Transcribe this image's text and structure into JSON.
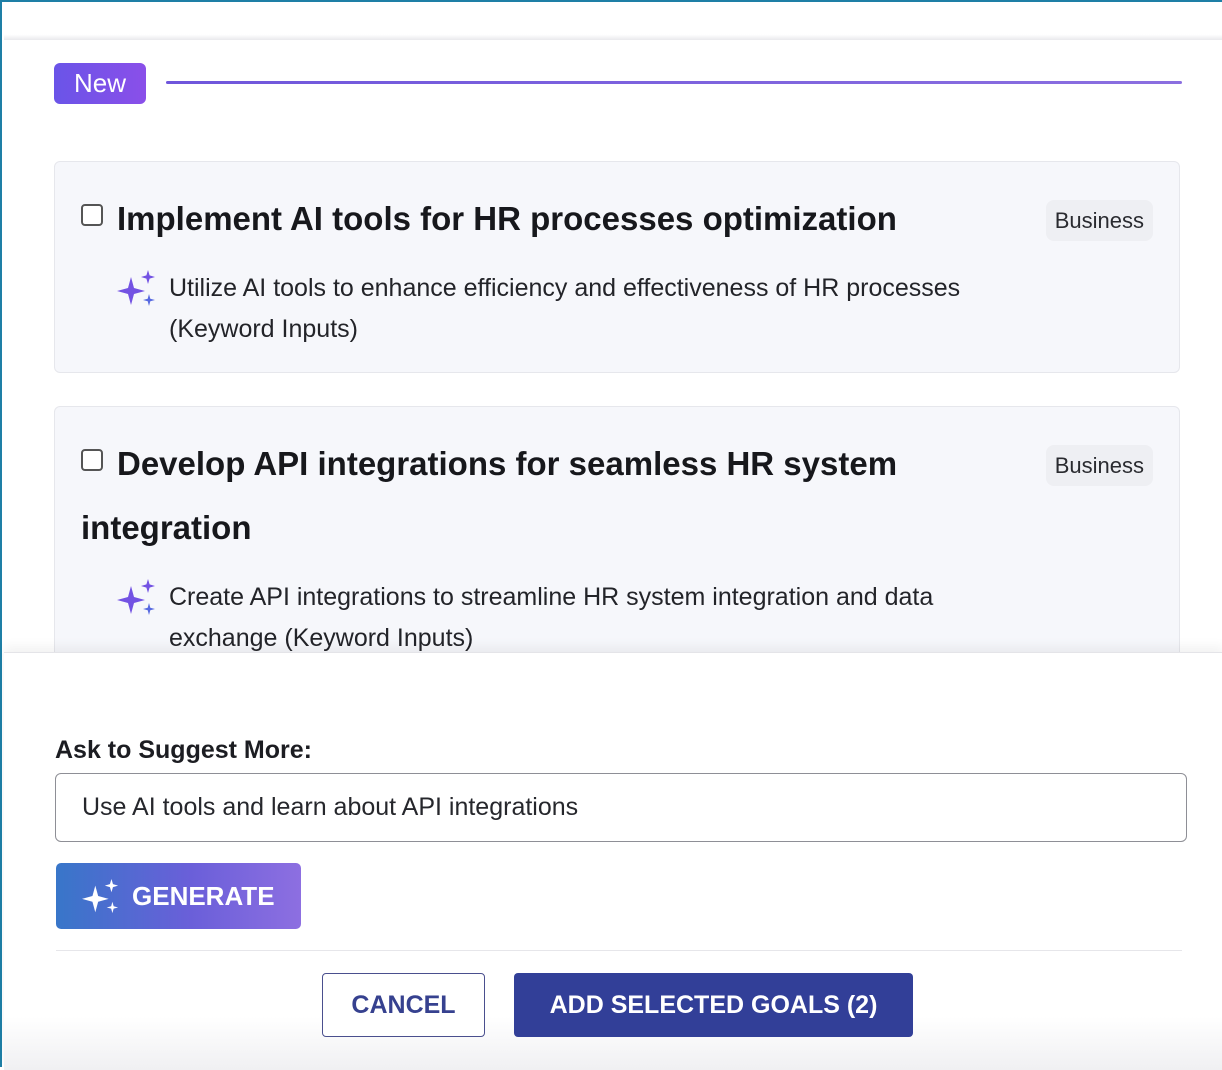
{
  "section": {
    "badge_label": "New"
  },
  "goals": [
    {
      "title": "Implement AI tools for HR processes optimization",
      "tag": "Business",
      "description": "Utilize AI tools to enhance efficiency and effectiveness of HR processes (Keyword Inputs)",
      "checked": false
    },
    {
      "title": "Develop API integrations for seamless HR system integration",
      "tag": "Business",
      "description": "Create API integrations to streamline HR system integration and data exchange (Keyword Inputs)",
      "checked": false
    }
  ],
  "suggest": {
    "label": "Ask to Suggest More:",
    "input_value": "Use AI tools and learn about API integrations",
    "generate_label": "GENERATE"
  },
  "actions": {
    "cancel_label": "CANCEL",
    "add_label": "ADD SELECTED GOALS (2)"
  },
  "colors": {
    "accent_purple": "#7a55e6",
    "primary_button": "#323f98",
    "frame_border": "#1e7fa6"
  },
  "icons": {
    "ai": "sparkle-icon"
  }
}
